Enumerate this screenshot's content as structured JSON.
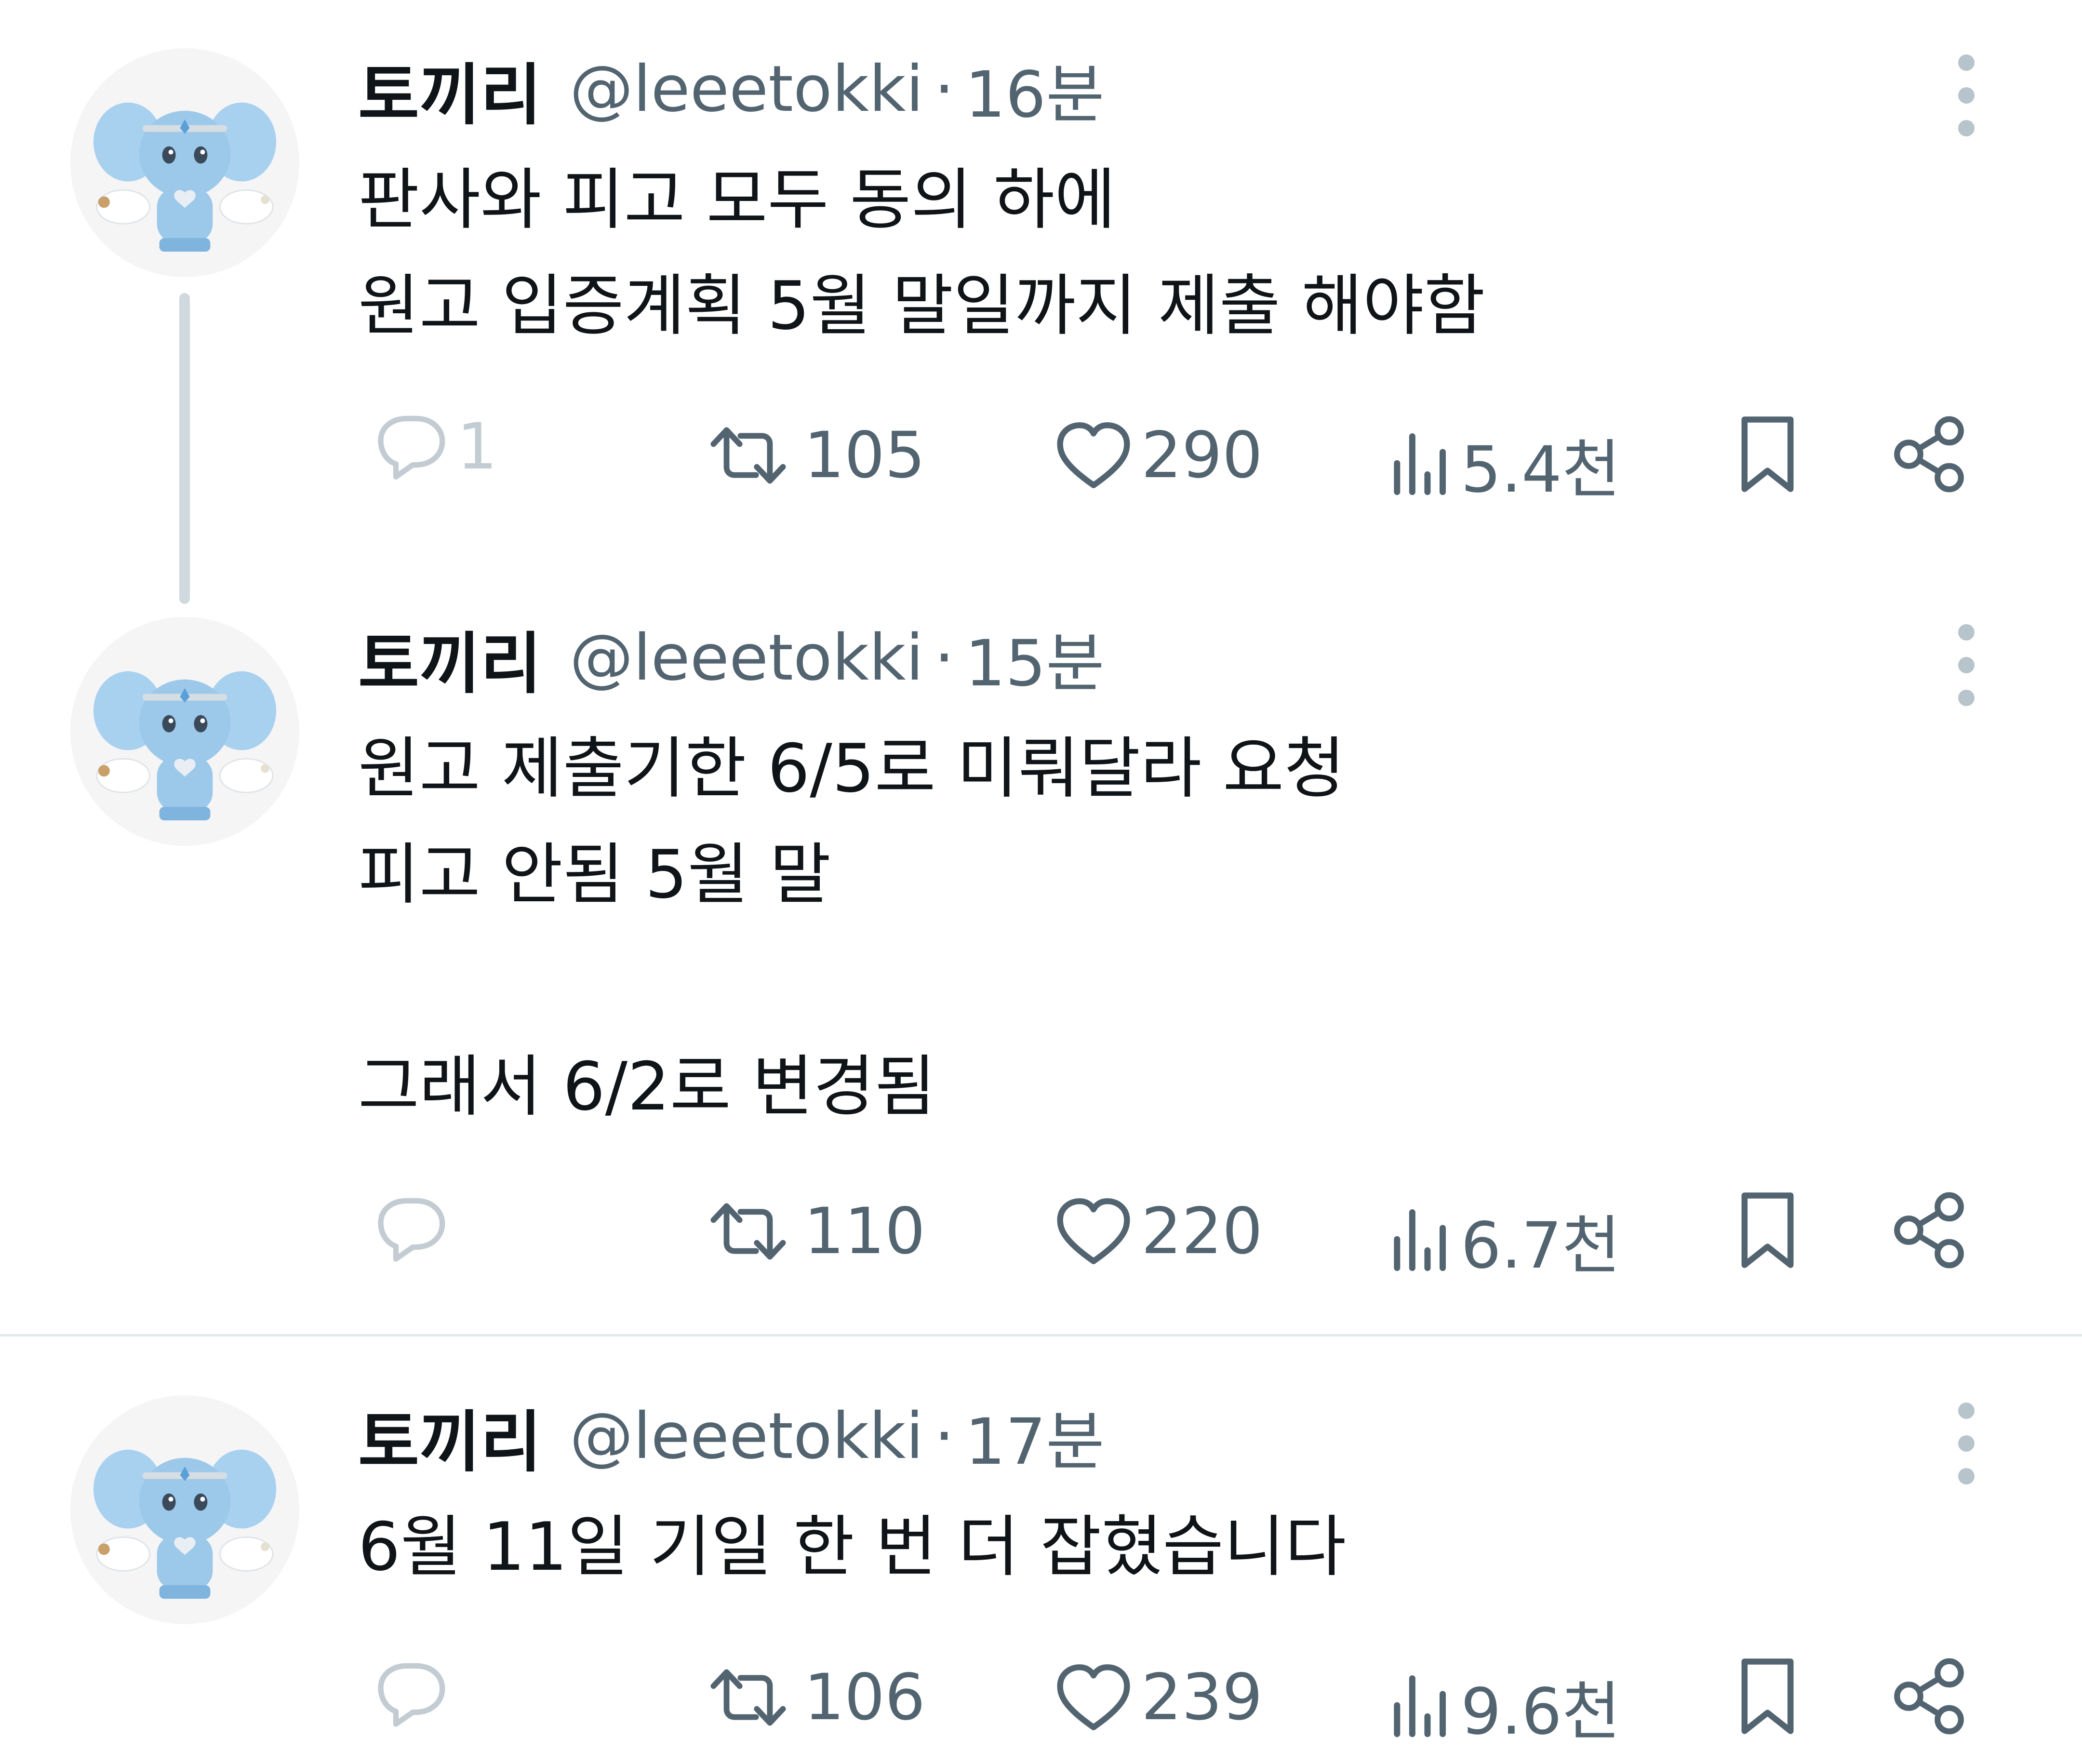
{
  "tweets": [
    {
      "display_name": "토끼리",
      "handle": "@leeetokki",
      "separator": "·",
      "time": "16분",
      "text": "판사와 피고 모두 동의 하에\n원고 입증계획 5월 말일까지 제출 해야함",
      "reply_count": "1",
      "retweet_count": "105",
      "like_count": "290",
      "view_count": "5.4천"
    },
    {
      "display_name": "토끼리",
      "handle": "@leeetokki",
      "separator": "·",
      "time": "15분",
      "text": "원고 제출기한 6/5로 미뤄달라 요청\n피고 안됨 5월 말\n\n그래서 6/2로 변경됨",
      "reply_count": "",
      "retweet_count": "110",
      "like_count": "220",
      "view_count": "6.7천"
    },
    {
      "display_name": "토끼리",
      "handle": "@leeetokki",
      "separator": "·",
      "time": "17분",
      "text": "6월 11일 기일 한 번 더 잡혔습니다",
      "reply_count": "",
      "retweet_count": "106",
      "like_count": "239",
      "view_count": "9.6천"
    }
  ],
  "icons": {
    "reply": "reply-icon",
    "retweet": "retweet-icon",
    "like": "heart-icon",
    "views": "views-icon",
    "bookmark": "bookmark-icon",
    "share": "share-icon",
    "more": "more-icon"
  },
  "colors": {
    "text": "#0f1419",
    "secondary": "#536471",
    "thread_line": "#cfd9de",
    "divider": "#e3e8eb",
    "avatar_figure": "#9cc8ea"
  }
}
